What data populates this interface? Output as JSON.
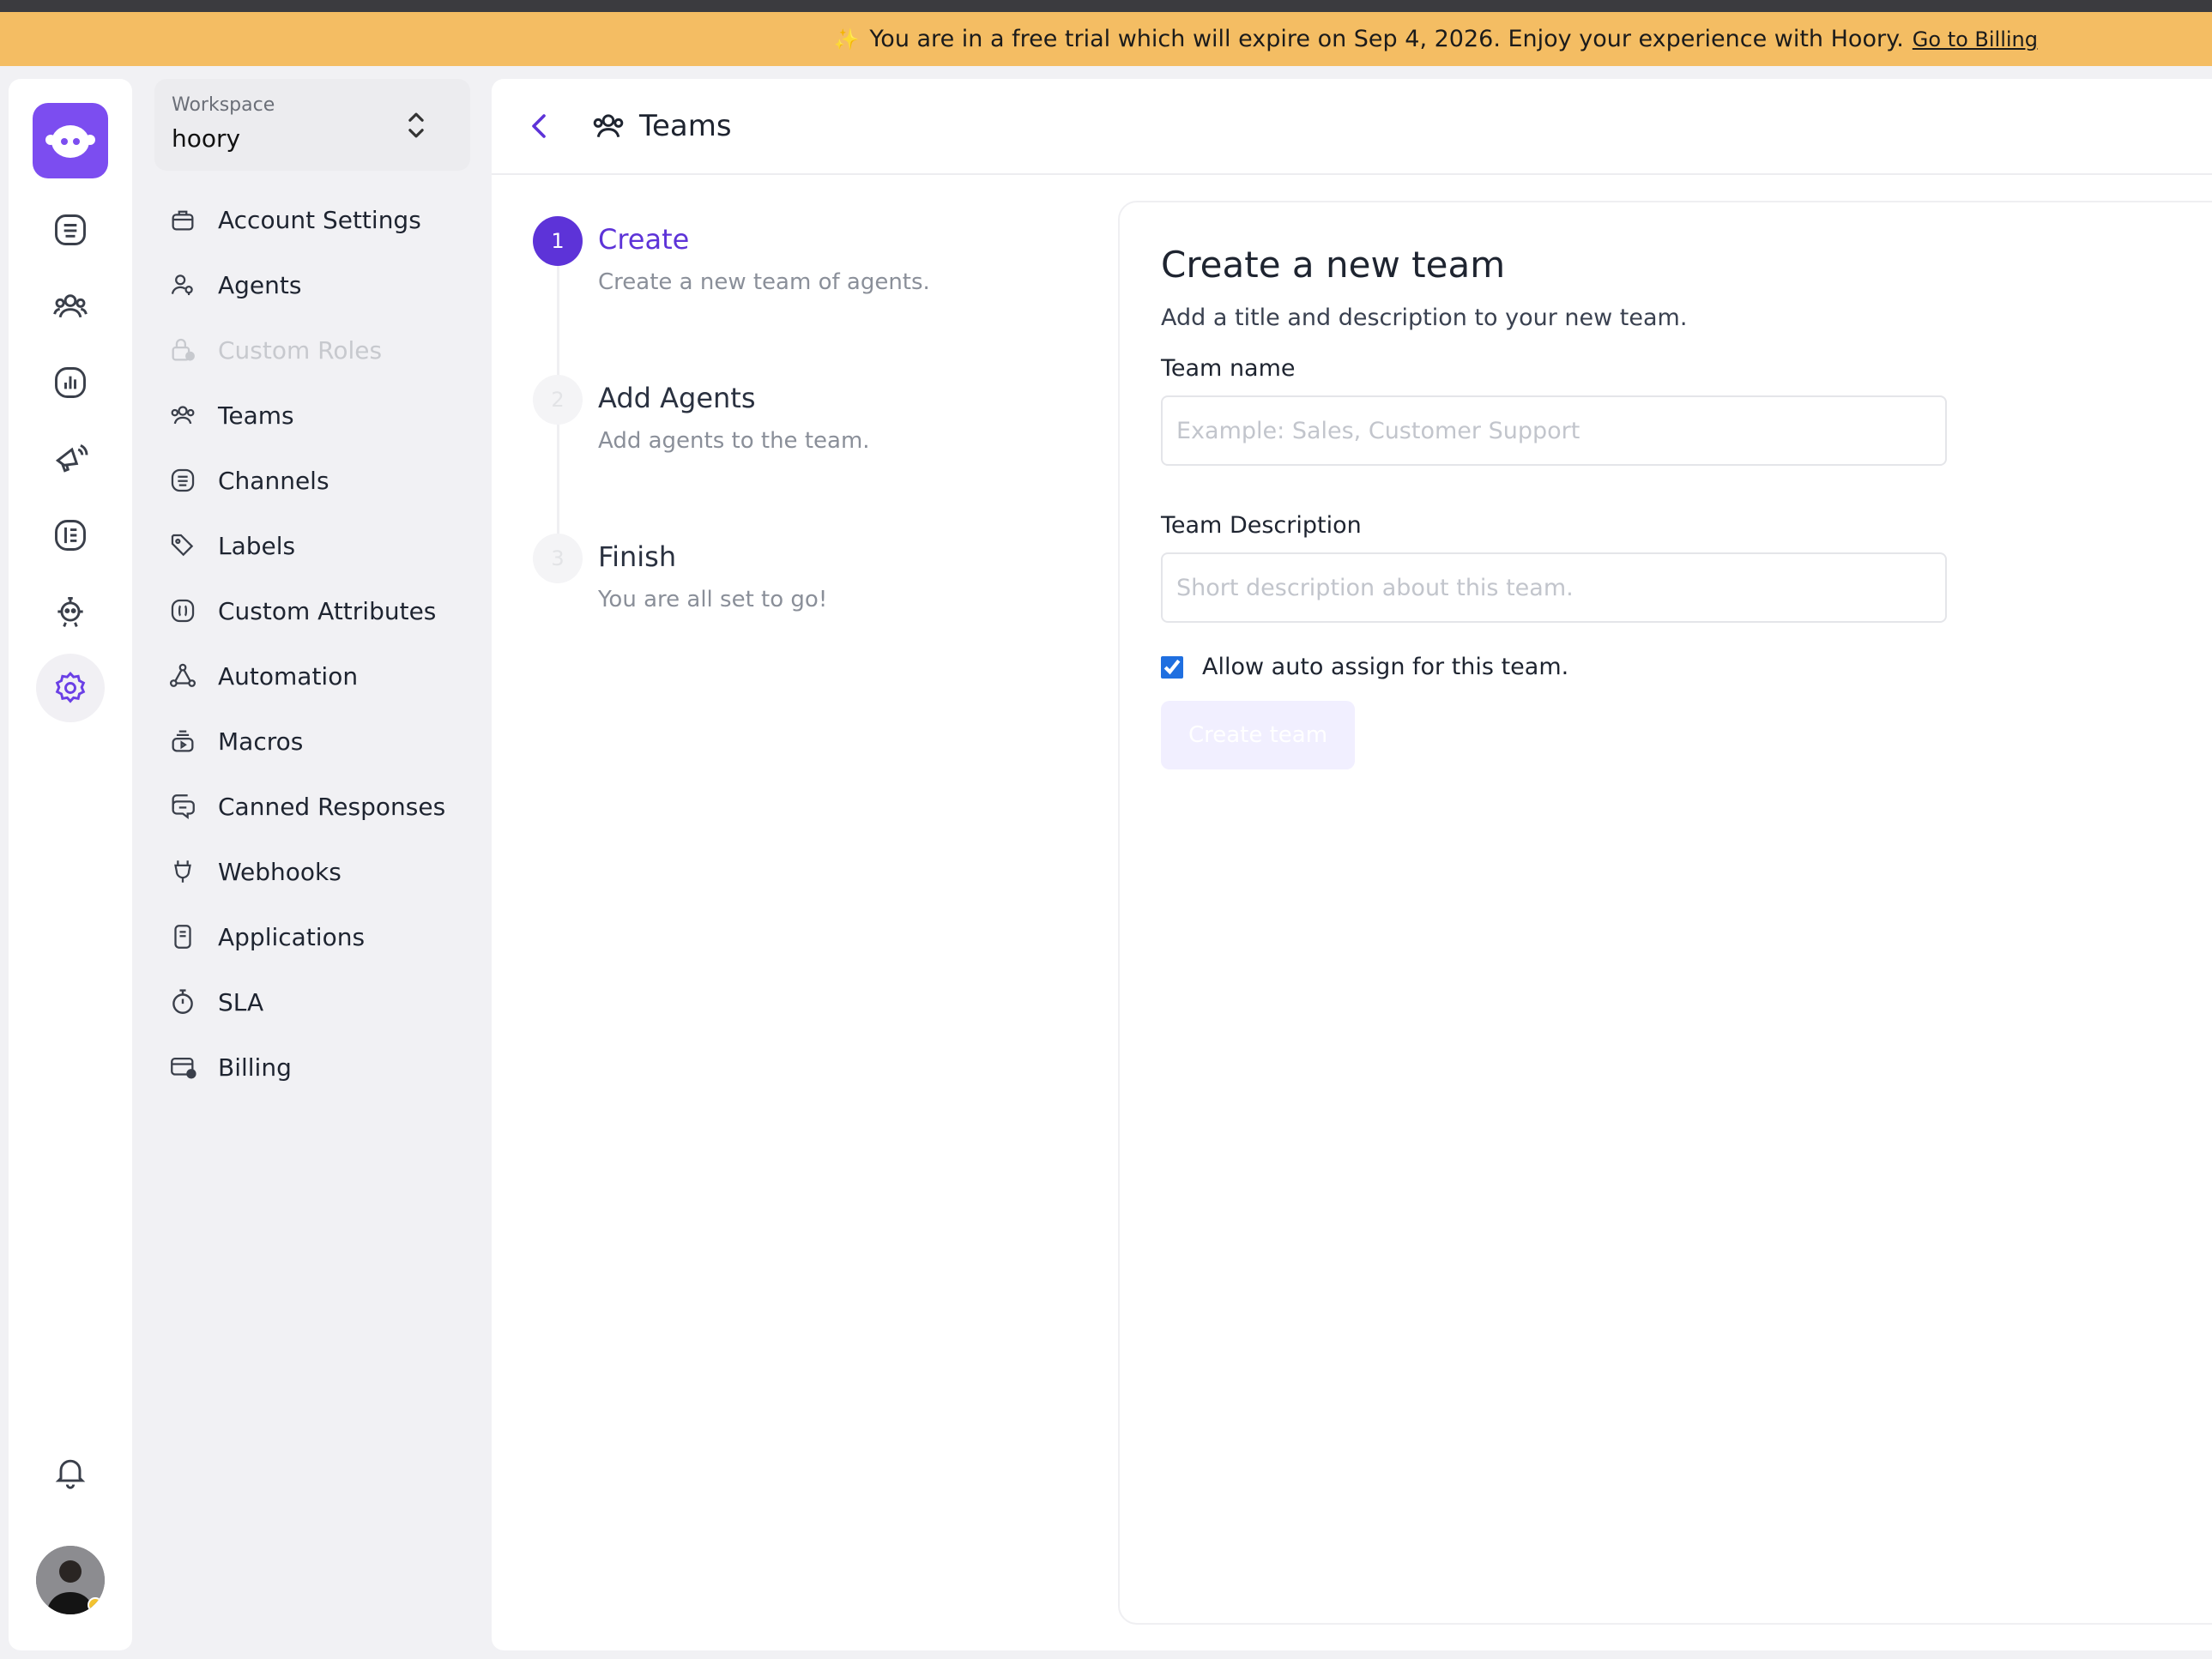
{
  "banner": {
    "message": "You are in a free trial which will expire on Sep 4, 2026. Enjoy your experience with Hoory.",
    "link": "Go to Billing",
    "spark": "✨"
  },
  "rail": {
    "icons": [
      "conversations-icon",
      "contacts-icon",
      "reports-icon",
      "campaigns-icon",
      "help-center-icon",
      "bot-icon",
      "settings-icon"
    ],
    "active": "settings-icon",
    "accent": "#7c4df0"
  },
  "workspace": {
    "label": "Workspace",
    "name": "hoory"
  },
  "sidebar": {
    "items": [
      {
        "label": "Account Settings",
        "icon": "briefcase-icon"
      },
      {
        "label": "Agents",
        "icon": "agents-icon"
      },
      {
        "label": "Custom Roles",
        "icon": "lock-icon",
        "disabled": true
      },
      {
        "label": "Teams",
        "icon": "teams-icon"
      },
      {
        "label": "Channels",
        "icon": "channels-icon"
      },
      {
        "label": "Labels",
        "icon": "tag-icon"
      },
      {
        "label": "Custom Attributes",
        "icon": "attributes-icon"
      },
      {
        "label": "Automation",
        "icon": "automation-icon"
      },
      {
        "label": "Macros",
        "icon": "macros-icon"
      },
      {
        "label": "Canned Responses",
        "icon": "chat-icon"
      },
      {
        "label": "Webhooks",
        "icon": "webhook-icon"
      },
      {
        "label": "Applications",
        "icon": "applications-icon"
      },
      {
        "label": "SLA",
        "icon": "timer-icon"
      },
      {
        "label": "Billing",
        "icon": "billing-icon"
      }
    ]
  },
  "header": {
    "title": "Teams"
  },
  "steps": [
    {
      "num": "1",
      "title": "Create",
      "desc": "Create a new team of agents."
    },
    {
      "num": "2",
      "title": "Add Agents",
      "desc": "Add agents to the team."
    },
    {
      "num": "3",
      "title": "Finish",
      "desc": "You are all set to go!"
    }
  ],
  "form": {
    "title": "Create a new team",
    "subtitle": "Add a title and description to your new team.",
    "name_label": "Team name",
    "name_placeholder": "Example: Sales, Customer Support",
    "name_value": "",
    "desc_label": "Team Description",
    "desc_placeholder": "Short description about this team.",
    "desc_value": "",
    "auto_assign_label": "Allow auto assign for this team.",
    "auto_assign_checked": true,
    "submit_label": "Create team"
  },
  "colors": {
    "banner": "#f4bd63",
    "primary": "#5d33d8",
    "checkbox": "#1f6fe0"
  }
}
